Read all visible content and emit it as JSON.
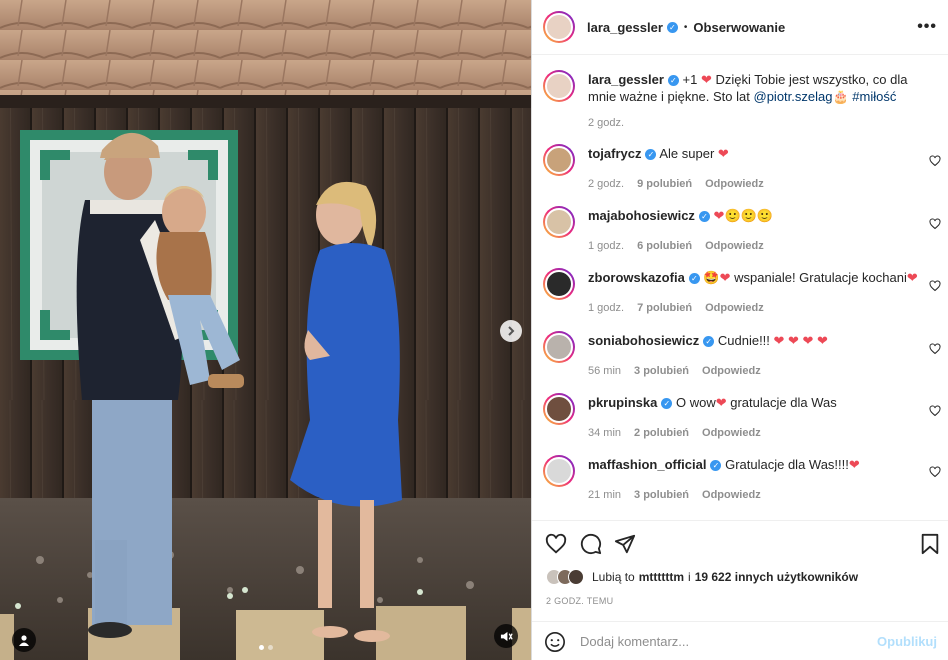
{
  "post_header": {
    "username": "lara_gessler",
    "follow_label": "Obserwowanie",
    "more_label": "•••"
  },
  "caption": {
    "username": "lara_gessler",
    "text_before": "+1",
    "text_after": "Dzięki Tobie jest wszystko, co dla mnie ważne i piękne. Sto lat",
    "mention": "@piotr.szelag",
    "hashtag": "#miłość",
    "time": "2 godz."
  },
  "comments": [
    {
      "username": "tojafrycz",
      "verified": true,
      "text": "Ale super",
      "time": "2 godz.",
      "likes": "9 polubień",
      "reply": "Odpowiedz",
      "avatar_color": "#c8a27a"
    },
    {
      "username": "majabohosiewicz",
      "verified": true,
      "text": "",
      "time": "1 godz.",
      "likes": "6 polubień",
      "reply": "Odpowiedz",
      "avatar_color": "#d8c2a6"
    },
    {
      "username": "zborowskazofia",
      "verified": true,
      "text": "wspaniale! Gratulacje kochani",
      "time": "1 godz.",
      "likes": "7 polubień",
      "reply": "Odpowiedz",
      "avatar_color": "#2a2a2a"
    },
    {
      "username": "soniabohosiewicz",
      "verified": true,
      "text": "Cudnie!!!",
      "time": "56 min",
      "likes": "3 polubień",
      "reply": "Odpowiedz",
      "avatar_color": "#b9b2ac"
    },
    {
      "username": "pkrupinska",
      "verified": true,
      "text": "O wow",
      "text_after": "gratulacje dla Was",
      "time": "34 min",
      "likes": "2 polubień",
      "reply": "Odpowiedz",
      "avatar_color": "#6f4f3f"
    },
    {
      "username": "maffashion_official",
      "verified": true,
      "text": "Gratulacje dla Was!!!!",
      "time": "21 min",
      "likes": "3 polubień",
      "reply": "Odpowiedz",
      "avatar_color": "#d9d9d9"
    }
  ],
  "likes_bar": {
    "prefix": "Lubią to",
    "user": "mttttttm",
    "connector": "i",
    "others": "19 622 innych użytkowników"
  },
  "time_ago": "2 GODZ. TEMU",
  "comment_input": {
    "placeholder": "Dodaj komentarz...",
    "publish_label": "Opublikuj"
  },
  "icons": {
    "like": "heart-icon",
    "comment": "comment-icon",
    "share": "paper-plane-icon",
    "save": "bookmark-icon",
    "emoji": "smiley-icon",
    "next": "chevron-right-icon",
    "mute": "speaker-muted-icon",
    "tag": "person-icon"
  },
  "colors": {
    "verified": "#3897f0",
    "heart": "#ed4956",
    "link": "#00376b",
    "publish_disabled": "#b2dffc"
  }
}
